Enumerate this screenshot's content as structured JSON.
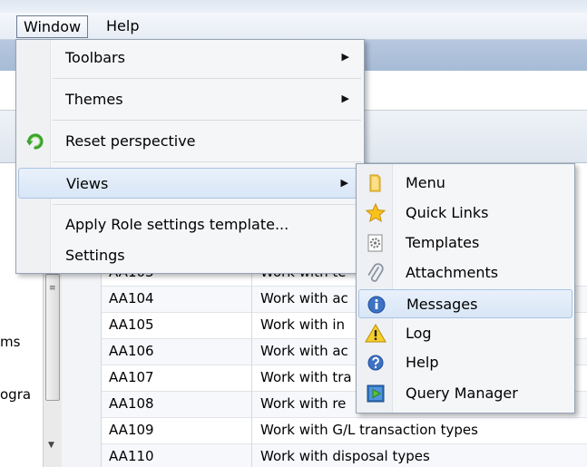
{
  "menubar": {
    "items": [
      {
        "label": "Window"
      },
      {
        "label": "Help"
      }
    ]
  },
  "window_menu": {
    "items": [
      {
        "label": "Toolbars",
        "has_submenu": true
      },
      {
        "label": "Themes",
        "has_submenu": true
      },
      {
        "label": "Reset perspective",
        "icon": "refresh-icon"
      },
      {
        "label": "Views",
        "has_submenu": true,
        "state": "highlighted"
      },
      {
        "label": "Apply Role settings template..."
      },
      {
        "label": "Settings"
      }
    ]
  },
  "views_menu": {
    "items": [
      {
        "label": "Menu",
        "icon": "folder-icon"
      },
      {
        "label": "Quick Links",
        "icon": "star-icon"
      },
      {
        "label": "Templates",
        "icon": "gear-doc-icon"
      },
      {
        "label": "Attachments",
        "icon": "paperclip-icon"
      },
      {
        "label": "Messages",
        "icon": "info-icon",
        "state": "highlighted"
      },
      {
        "label": "Log",
        "icon": "warning-icon"
      },
      {
        "label": "Help",
        "icon": "help-icon"
      },
      {
        "label": "Query Manager",
        "icon": "query-manager-icon"
      }
    ]
  },
  "left_panel": {
    "items": [
      "ms",
      "ogra"
    ]
  },
  "grid": {
    "rows": [
      {
        "code": "AA103",
        "description": "Work with te"
      },
      {
        "code": "AA104",
        "description": "Work with ac"
      },
      {
        "code": "AA105",
        "description": "Work with in"
      },
      {
        "code": "AA106",
        "description": "Work with ac"
      },
      {
        "code": "AA107",
        "description": "Work with tra"
      },
      {
        "code": "AA108",
        "description": "Work with re"
      },
      {
        "code": "AA109",
        "description": "Work with G/L transaction types"
      },
      {
        "code": "AA110",
        "description": "Work with disposal types"
      }
    ]
  },
  "colors": {
    "menu_highlight": "#d8e6f6",
    "menu_highlight_border": "#a9c3e3",
    "ribbon_blue": "#a6bbd6"
  }
}
